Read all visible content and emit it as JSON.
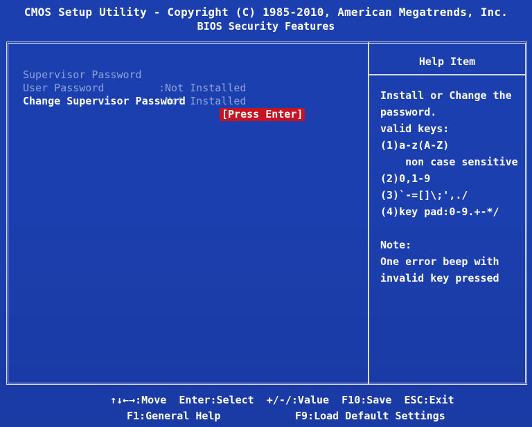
{
  "header": {
    "title": "CMOS Setup Utility - Copyright (C) 1985-2010, American Megatrends, Inc.",
    "subtitle": "BIOS Security Features"
  },
  "menu": {
    "items": [
      {
        "label": "Supervisor Password",
        "value": ":Not Installed"
      },
      {
        "label": "User Password",
        "value": ":Not Installed"
      },
      {
        "label": "Change Supervisor Password",
        "value": "[Press Enter]"
      }
    ]
  },
  "help": {
    "title": "Help Item",
    "lines": [
      "Install or Change the",
      "password.",
      "valid keys:",
      "(1)a-z(A-Z)",
      "    non case sensitive",
      "(2)0,1-9",
      "(3)`-=[]\\;',./",
      "(4)key pad:0-9.+-*/",
      "",
      "Note:",
      "One error beep with",
      "invalid key pressed"
    ]
  },
  "footer": {
    "line1": "↑↓←→:Move  Enter:Select  +/-/:Value  F10:Save  ESC:Exit",
    "line2_left": "F1:General Help",
    "line2_right": "F9:Load Default Settings"
  },
  "colors": {
    "background": "#1b3fae",
    "highlight": "#c81422",
    "disabled_text": "#8fa3d6",
    "border": "#d8dde8"
  }
}
